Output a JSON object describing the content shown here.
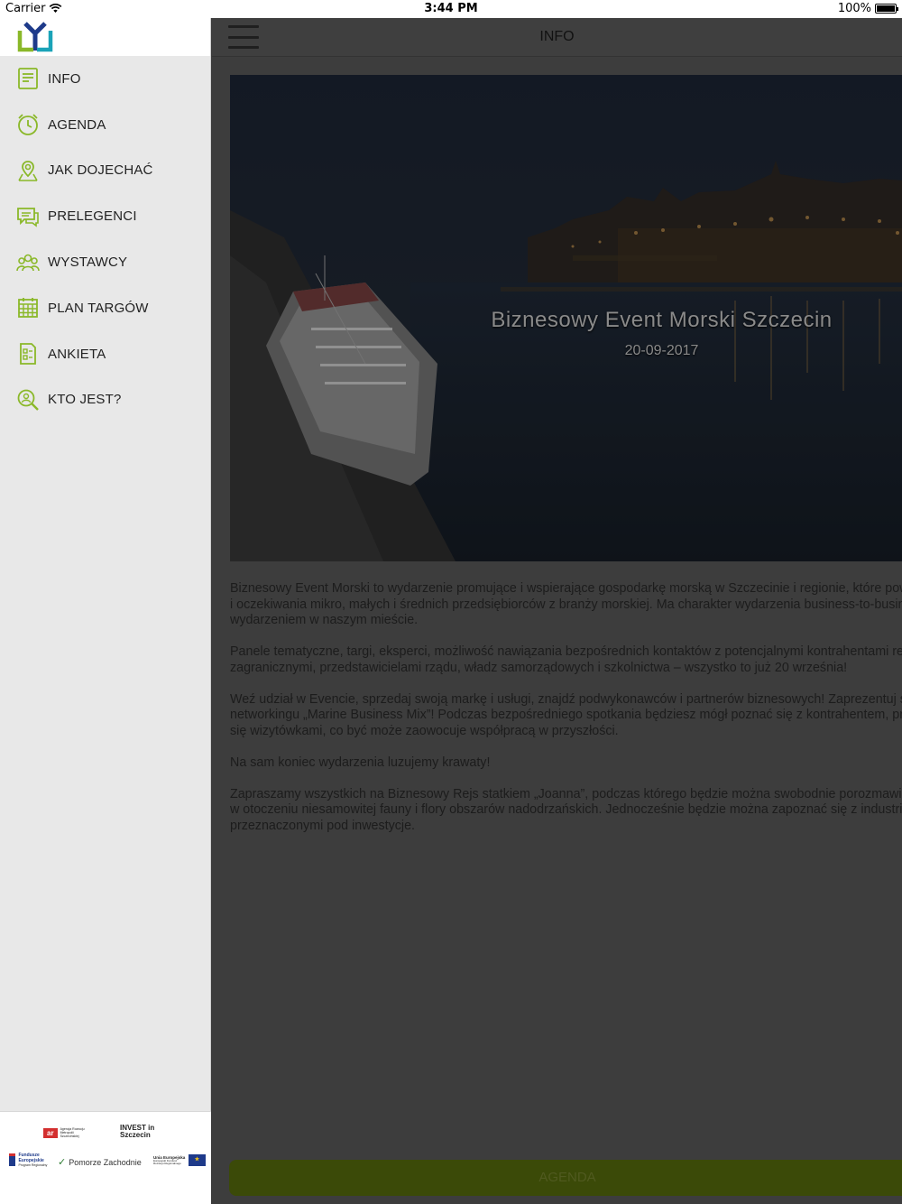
{
  "status_bar": {
    "carrier": "Carrier",
    "time": "3:44 PM",
    "battery": "100%"
  },
  "sidebar": {
    "items": [
      {
        "label": "INFO",
        "icon": "document-icon"
      },
      {
        "label": "AGENDA",
        "icon": "clock-icon"
      },
      {
        "label": "JAK DOJECHAĆ",
        "icon": "map-pin-icon"
      },
      {
        "label": "PRELEGENCI",
        "icon": "chat-icon"
      },
      {
        "label": "WYSTAWCY",
        "icon": "people-icon"
      },
      {
        "label": "PLAN TARGÓW",
        "icon": "calendar-grid-icon"
      },
      {
        "label": "ANKIETA",
        "icon": "survey-icon"
      },
      {
        "label": "KTO JEST?",
        "icon": "search-person-icon"
      }
    ],
    "sponsors": {
      "arr": "ar",
      "arr_text": "Agencja Rozwoju Metropolii Szczecińskiej",
      "invest": "INVEST in Szczecin",
      "fe": "Fundusze Europejskie",
      "fe_sub": "Program Regionalny",
      "pomorze": "Pomorze Zachodnie",
      "ue": "Unia Europejska",
      "ue_sub": "Europejski Fundusz Rozwoju Regionalnego"
    }
  },
  "main": {
    "title": "INFO",
    "hero_title": "Biznesowy Event Morski Szczecin",
    "hero_date": "20-09-2017",
    "paragraphs": [
      "Biznesowy Event Morski to wydarzenie promujące i wspierające gospodarkę morską w Szczecinie i regionie, które pow\ni oczekiwania mikro, małych i średnich przedsiębiorców z branży morskiej. Ma charakter wydarzenia business-to-busin\nwydarzeniem w naszym mieście.",
      "Panele tematyczne, targi, eksperci, możliwość nawiązania bezpośrednich kontaktów z potencjalnymi kontrahentami re\nzagranicznymi, przedstawicielami rządu, władz samorządowych i szkolnictwa – wszystko to już 20 września!",
      "Weź udział w Evencie, sprzedaj swoją markę i usługi, znajdź podwykonawców i partnerów biznesowych! Zaprezentuj s\nnetworkingu „Marine Business Mix”! Podczas bezpośredniego spotkania będziesz mógł poznać się z kontrahentem, pr\nsię wizytówkami, co być może zaowocuje współpracą w przyszłości.",
      "Na sam koniec wydarzenia luzujemy krawaty!",
      "Zapraszamy wszystkich na Biznesowy Rejs statkiem „Joanna”, podczas którego będzie można swobodnie porozmawiać\nw otoczeniu niesamowitej fauny i flory obszarów nadodrzańskich. Jednocześnie będzie można zapoznać się z industria\nprzeznaczonymi pod inwestycje."
    ],
    "agenda_button": "AGENDA"
  }
}
